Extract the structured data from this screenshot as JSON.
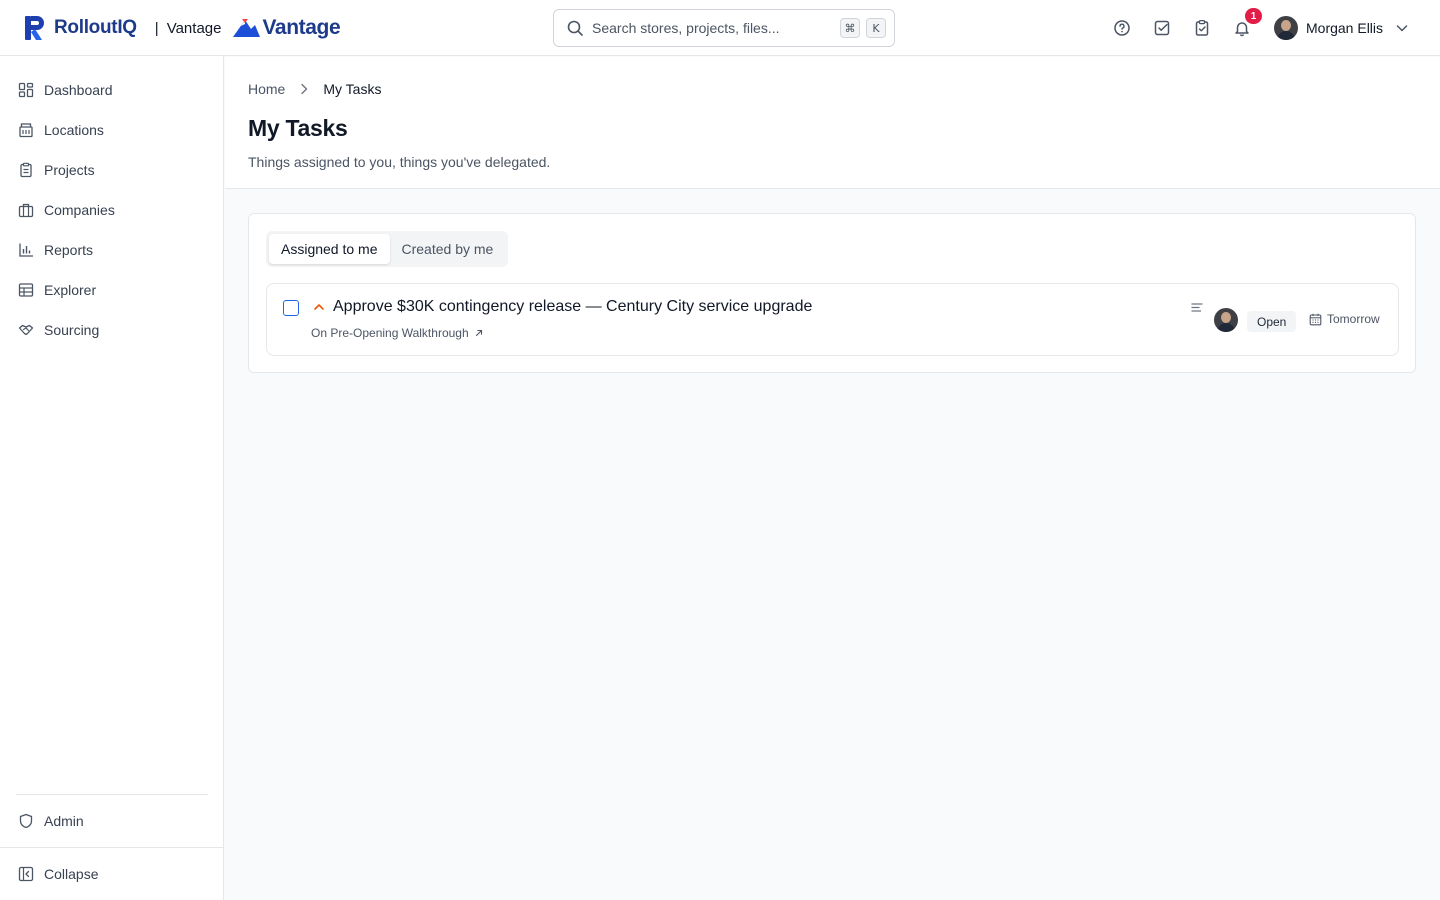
{
  "topbar": {
    "brand_name": "RolloutIQ",
    "separator": "|",
    "tenant_name": "Vantage",
    "tenant_logo_text": "Vantage",
    "search_placeholder": "Search stores, projects, files...",
    "shortcut_cmd": "⌘",
    "shortcut_key": "K",
    "notification_count": "1",
    "user_name": "Morgan Ellis",
    "icons": [
      "help-icon",
      "task-check-icon",
      "clipboard-icon",
      "bell-icon",
      "chevron-down-icon"
    ]
  },
  "sidebar": {
    "items": [
      {
        "label": "Dashboard",
        "icon": "dashboard-icon"
      },
      {
        "label": "Locations",
        "icon": "building-icon"
      },
      {
        "label": "Projects",
        "icon": "clipboard-icon"
      },
      {
        "label": "Companies",
        "icon": "briefcase-icon"
      },
      {
        "label": "Reports",
        "icon": "bar-chart-icon"
      },
      {
        "label": "Explorer",
        "icon": "table-icon"
      },
      {
        "label": "Sourcing",
        "icon": "handshake-icon"
      }
    ],
    "admin_label": "Admin",
    "collapse_label": "Collapse"
  },
  "breadcrumb": {
    "home": "Home",
    "current": "My Tasks"
  },
  "page": {
    "title": "My Tasks",
    "subtitle": "Things assigned to you, things you've delegated."
  },
  "tabs": [
    {
      "label": "Assigned to me",
      "active": true
    },
    {
      "label": "Created by me",
      "active": false
    }
  ],
  "tasks": [
    {
      "title": "Approve $30K contingency release — Century City service upgrade",
      "parent": "On Pre-Opening Walkthrough",
      "priority": "high",
      "status": "Open",
      "due": "Tomorrow",
      "completed": false
    }
  ],
  "colors": {
    "brand": "#1e3a8a",
    "accent": "#2563eb",
    "priority_high": "#ea580c",
    "badge": "#e11d48"
  }
}
